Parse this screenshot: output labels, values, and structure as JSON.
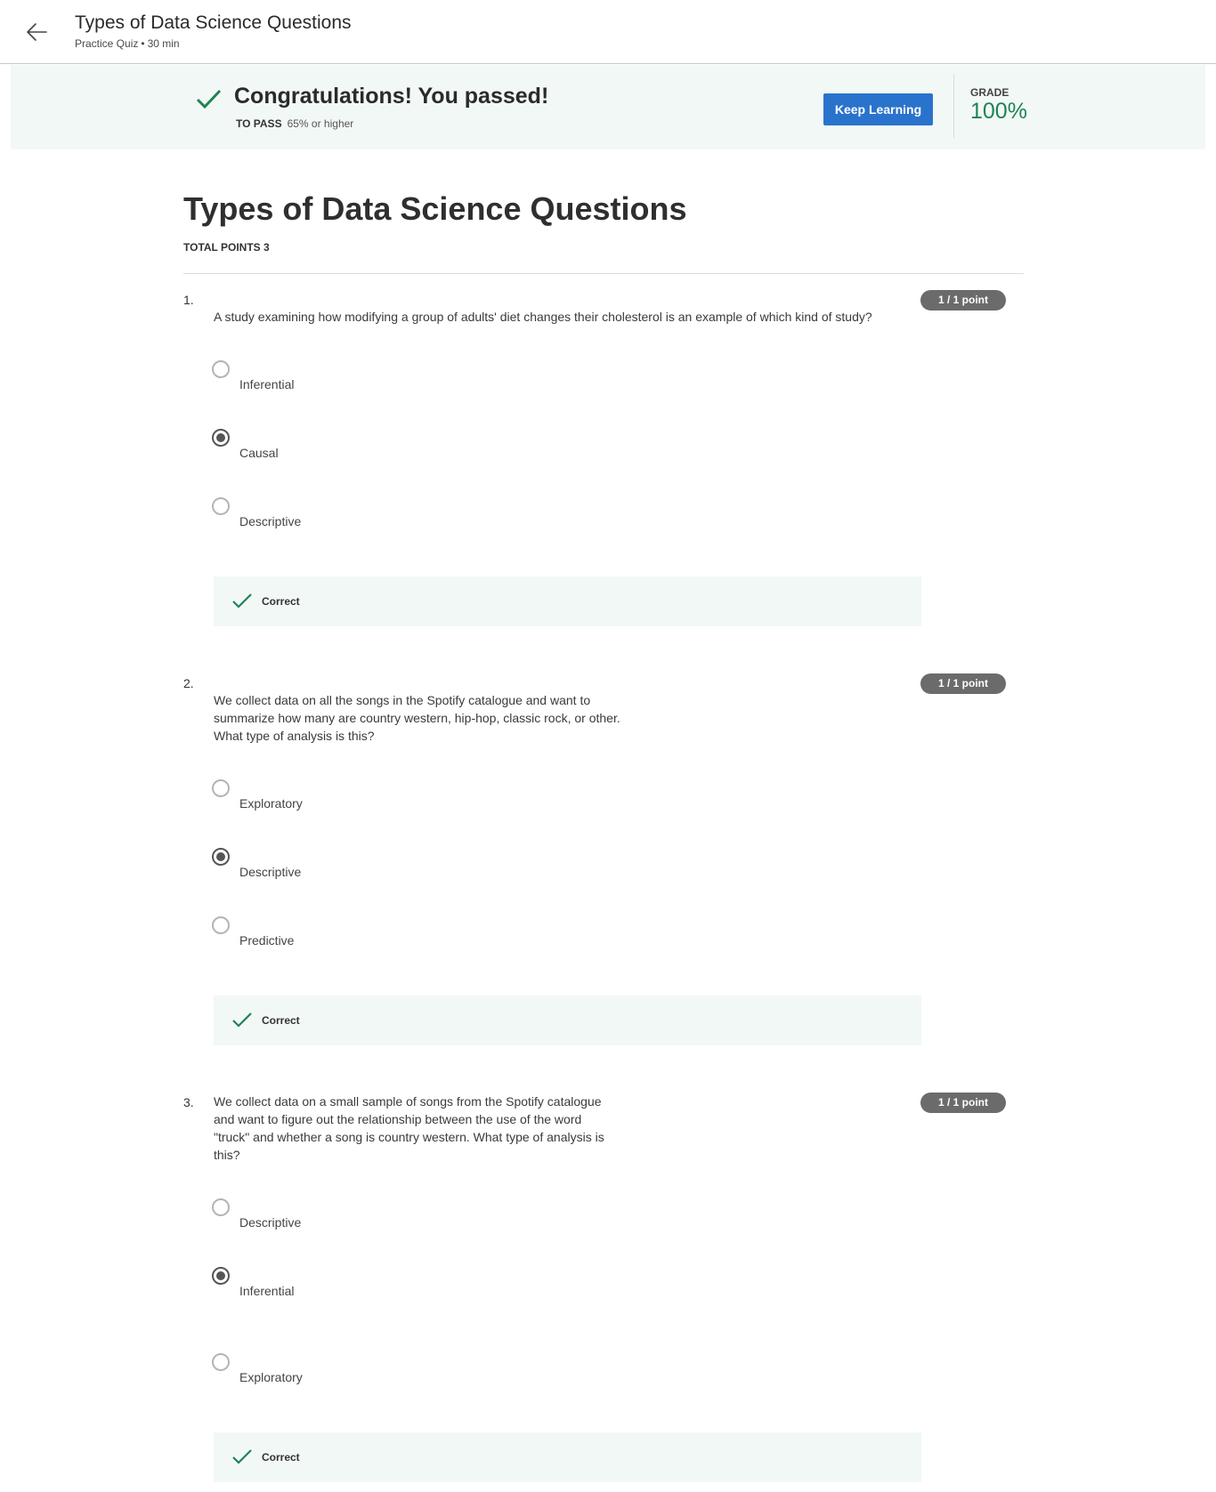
{
  "header": {
    "title": "Types of Data Science Questions",
    "subtitle_type": "Practice Quiz",
    "subtitle_sep": "•",
    "subtitle_duration": "30 min"
  },
  "banner": {
    "title": "Congratulations! You passed!",
    "pass_label": "TO PASS",
    "pass_value": "65% or higher",
    "keep_learning_label": "Keep Learning",
    "grade_label": "GRADE",
    "grade_value": "100%",
    "accent_color": "#1f8354",
    "button_color": "#2a73cc"
  },
  "quiz": {
    "title": "Types of Data Science Questions",
    "total_points": "TOTAL POINTS 3",
    "questions": [
      {
        "number": "1.",
        "text": "A study examining how modifying a group of adults' diet changes their cholesterol is an example of which kind of study?",
        "points": "1 / 1 point",
        "options": [
          {
            "label": "Inferential",
            "selected": false
          },
          {
            "label": "Causal",
            "selected": true
          },
          {
            "label": "Descriptive",
            "selected": false
          }
        ],
        "feedback": "Correct"
      },
      {
        "number": "2.",
        "text": "We collect data on all the songs in the Spotify catalogue and want to\nsummarize how many are country western, hip-hop, classic rock, or other.\n What type of analysis is this?",
        "points": "1 / 1 point",
        "options": [
          {
            "label": "Exploratory",
            "selected": false
          },
          {
            "label": "Descriptive",
            "selected": true
          },
          {
            "label": "Predictive",
            "selected": false
          }
        ],
        "feedback": "Correct"
      },
      {
        "number": "3.",
        "text": "We collect data on a small sample of songs from the Spotify catalogue\nand want to figure out the relationship between the use of the word\n\"truck\" and whether a song is country western. What type of analysis is\nthis?",
        "points": "1 / 1 point",
        "options": [
          {
            "label": "Descriptive",
            "selected": false
          },
          {
            "label": "Inferential",
            "selected": true
          },
          {
            "label": "Exploratory",
            "selected": false
          }
        ],
        "feedback": "Correct"
      }
    ]
  }
}
